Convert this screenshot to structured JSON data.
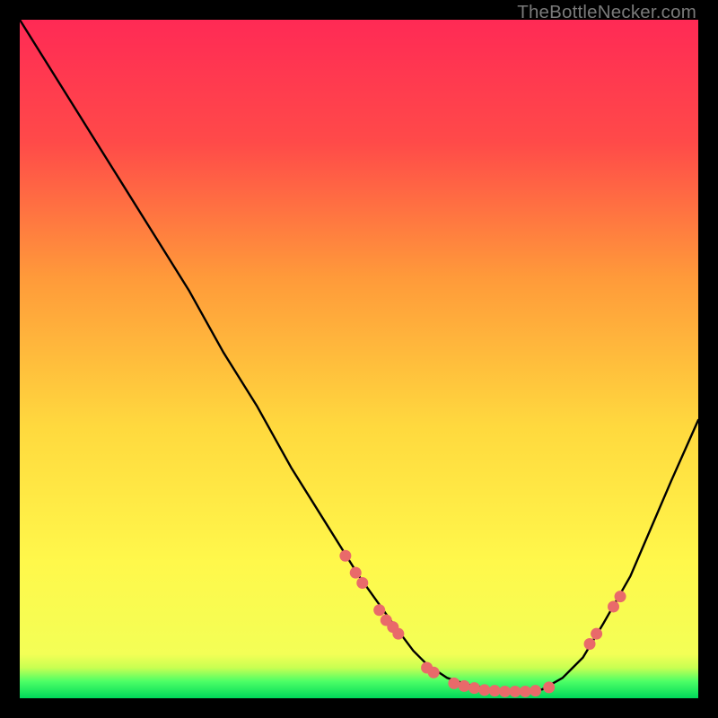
{
  "watermark": "TheBottleNecker.com",
  "chart_data": {
    "type": "line",
    "title": "",
    "xlabel": "",
    "ylabel": "",
    "xlim": [
      0,
      100
    ],
    "ylim": [
      0,
      100
    ],
    "grid": false,
    "legend": false,
    "background_gradient": {
      "top": "#ff2a55",
      "mid_upper": "#ff7a3c",
      "mid": "#ffed47",
      "lower": "#f6ff5e",
      "bottom_band": "#00e05b"
    },
    "series": [
      {
        "name": "curve",
        "color": "#000000",
        "x": [
          0,
          5,
          10,
          15,
          20,
          25,
          30,
          35,
          40,
          45,
          50,
          55,
          58,
          60,
          63,
          66,
          70,
          74,
          77,
          80,
          83,
          86,
          90,
          93,
          96,
          100
        ],
        "y": [
          100,
          92,
          84,
          76,
          68,
          60,
          51,
          43,
          34,
          26,
          18,
          11,
          7,
          5,
          3,
          2,
          1.2,
          1,
          1.3,
          3,
          6,
          11,
          18,
          25,
          32,
          41
        ]
      }
    ],
    "markers": [
      {
        "name": "dots",
        "color": "#e96a6a",
        "points": [
          {
            "x": 48,
            "y": 21
          },
          {
            "x": 49.5,
            "y": 18.5
          },
          {
            "x": 50.5,
            "y": 17
          },
          {
            "x": 53,
            "y": 13
          },
          {
            "x": 54,
            "y": 11.5
          },
          {
            "x": 55,
            "y": 10.5
          },
          {
            "x": 55.8,
            "y": 9.5
          },
          {
            "x": 60,
            "y": 4.5
          },
          {
            "x": 61,
            "y": 3.8
          },
          {
            "x": 64,
            "y": 2.2
          },
          {
            "x": 65.5,
            "y": 1.8
          },
          {
            "x": 67,
            "y": 1.5
          },
          {
            "x": 68.5,
            "y": 1.2
          },
          {
            "x": 70,
            "y": 1.1
          },
          {
            "x": 71.5,
            "y": 1.0
          },
          {
            "x": 73,
            "y": 1.0
          },
          {
            "x": 74.5,
            "y": 1.0
          },
          {
            "x": 76,
            "y": 1.1
          },
          {
            "x": 78,
            "y": 1.6
          },
          {
            "x": 84,
            "y": 8
          },
          {
            "x": 85,
            "y": 9.5
          },
          {
            "x": 87.5,
            "y": 13.5
          },
          {
            "x": 88.5,
            "y": 15
          }
        ]
      }
    ]
  }
}
